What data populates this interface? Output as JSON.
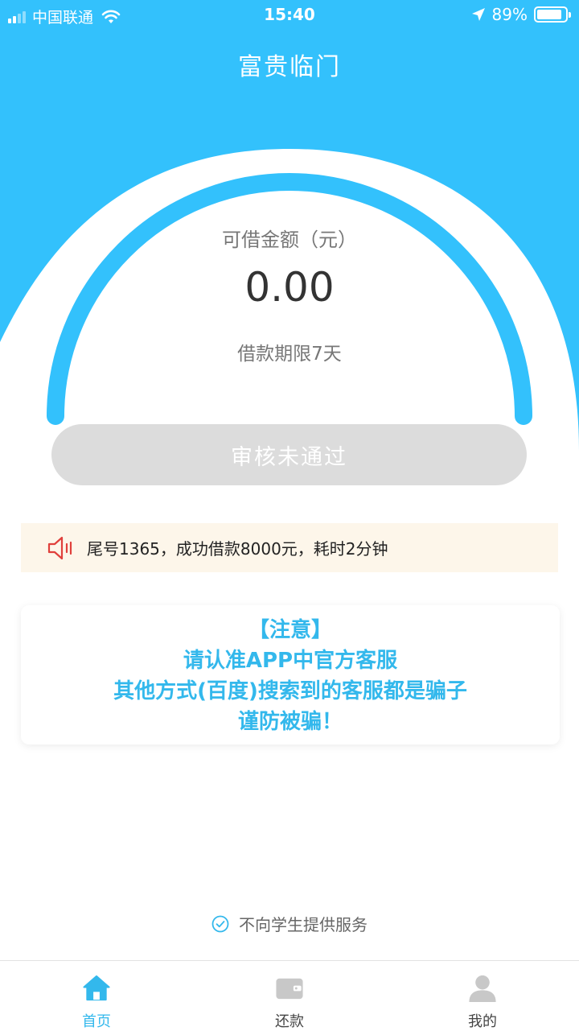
{
  "status_bar": {
    "carrier": "中国联通",
    "time": "15:40",
    "battery_percent": "89%",
    "battery_level": 0.89
  },
  "header": {
    "title": "富贵临门"
  },
  "loan_gauge": {
    "label": "可借金额（元）",
    "amount": "0.00",
    "term": "借款期限7天",
    "accent_color": "#33c1fc"
  },
  "status_button": {
    "label": "审核未通过"
  },
  "notice": {
    "icon": "speaker-icon",
    "text": "尾号1365，成功借款8000元，耗时2分钟"
  },
  "warning": {
    "lines": [
      "【注意】",
      "请认准APP中官方客服",
      "其他方式(百度)搜索到的客服都是骗子",
      "谨防被骗！"
    ]
  },
  "footer_note": {
    "icon": "check-circle-icon",
    "text": "不向学生提供服务"
  },
  "tabbar": {
    "tabs": [
      {
        "label": "首页",
        "icon": "home-icon",
        "active": true
      },
      {
        "label": "还款",
        "icon": "wallet-icon",
        "active": false
      },
      {
        "label": "我的",
        "icon": "user-icon",
        "active": false
      }
    ]
  }
}
